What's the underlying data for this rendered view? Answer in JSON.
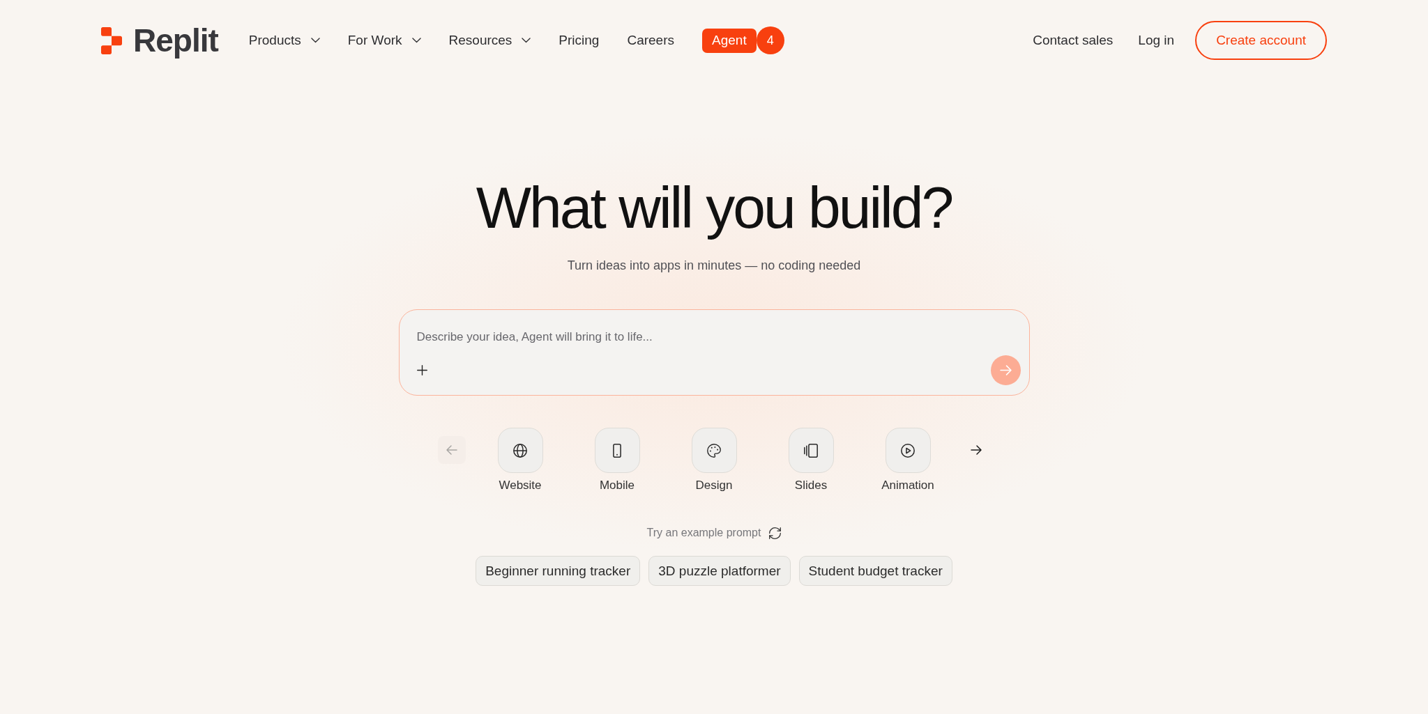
{
  "header": {
    "logo": {
      "text": "Replit"
    },
    "nav": [
      {
        "label": "Products",
        "kind": "menu"
      },
      {
        "label": "For Work",
        "kind": "menu"
      },
      {
        "label": "Resources",
        "kind": "menu"
      },
      {
        "label": "Pricing",
        "kind": "link"
      },
      {
        "label": "Careers",
        "kind": "link"
      }
    ],
    "agent": {
      "label": "Agent",
      "count": "4"
    },
    "actions": [
      {
        "label": "Contact sales",
        "kind": "link"
      },
      {
        "label": "Log in",
        "kind": "link"
      },
      {
        "label": "Create account",
        "kind": "outline"
      }
    ]
  },
  "hero": {
    "title": "What will you build?",
    "subtitle": "Turn ideas into apps in minutes — no coding needed"
  },
  "prompt": {
    "placeholder": "Describe your idea, Agent will bring it to life...",
    "send": {
      "disabled": true
    }
  },
  "categories": {
    "previous": {
      "disabled": true
    },
    "next": {
      "disabled": false
    },
    "items": [
      {
        "label": "Website"
      },
      {
        "label": "Mobile"
      },
      {
        "label": "Design"
      },
      {
        "label": "Slides"
      },
      {
        "label": "Animation"
      }
    ]
  },
  "examples": {
    "label": "Try an example prompt",
    "prompts": [
      "Beginner running tracker",
      "3D puzzle platformer",
      "Student budget tracker"
    ]
  }
}
